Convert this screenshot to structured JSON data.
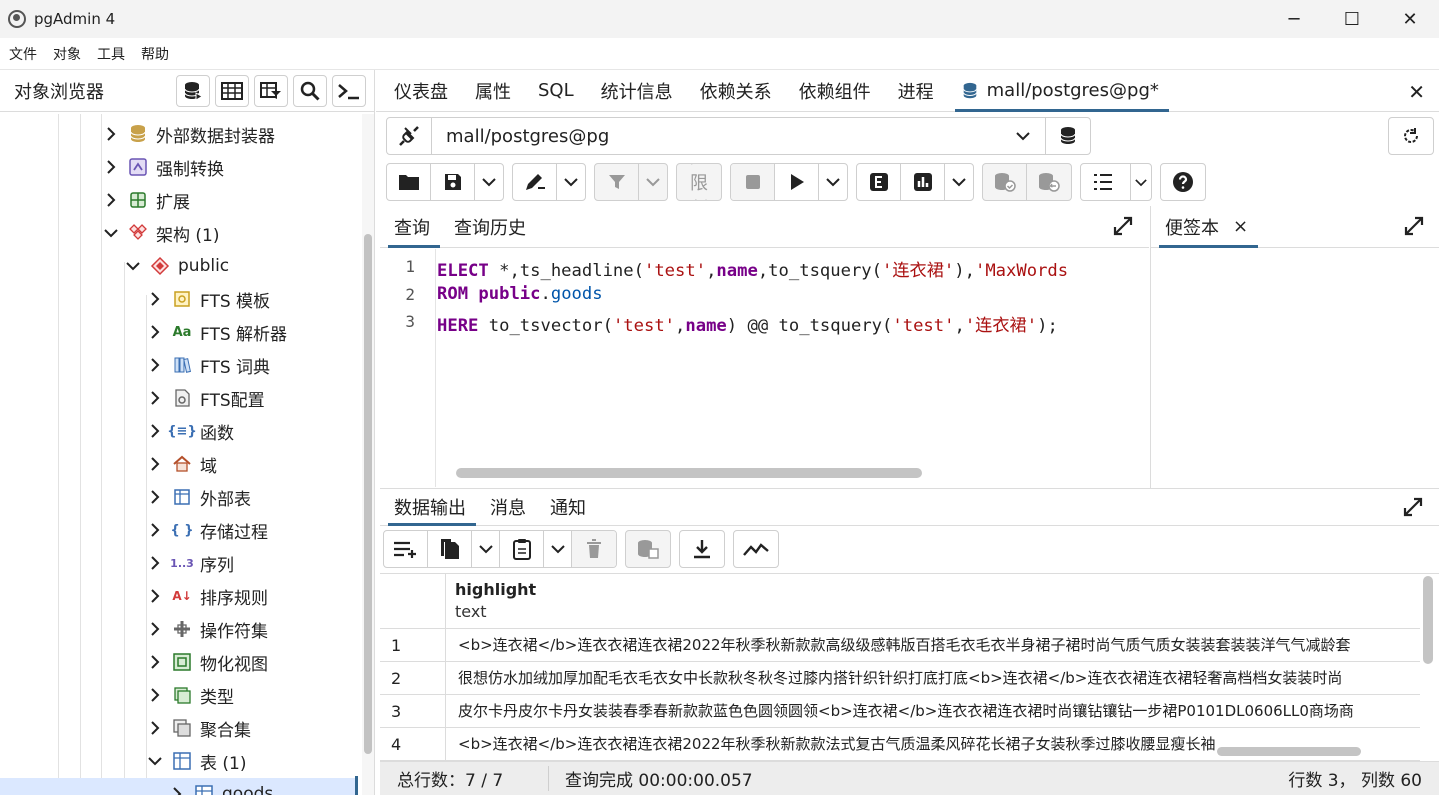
{
  "window": {
    "title": "pgAdmin 4",
    "minimize": "─",
    "maximize": "☐",
    "close": "✕"
  },
  "menubar": [
    "文件",
    "对象",
    "工具",
    "帮助"
  ],
  "browser": {
    "title": "对象浏览器",
    "tree": [
      {
        "label": "外部数据封装器",
        "icon": "database-stack-icon",
        "level": 0,
        "expanded": false
      },
      {
        "label": "强制转换",
        "icon": "cast-icon",
        "level": 0,
        "expanded": false
      },
      {
        "label": "扩展",
        "icon": "extension-icon",
        "level": 0,
        "expanded": false
      },
      {
        "label": "架构 (1)",
        "icon": "schemas-icon",
        "level": 0,
        "expanded": true
      },
      {
        "label": "public",
        "icon": "schema-icon",
        "level": 1,
        "expanded": true
      },
      {
        "label": "FTS 模板",
        "icon": "fts-template-icon",
        "level": 2,
        "expanded": false
      },
      {
        "label": "FTS 解析器",
        "icon": "fts-parser-icon",
        "level": 2,
        "expanded": false
      },
      {
        "label": "FTS 词典",
        "icon": "fts-dictionary-icon",
        "level": 2,
        "expanded": false
      },
      {
        "label": "FTS配置",
        "icon": "fts-config-icon",
        "level": 2,
        "expanded": false
      },
      {
        "label": "函数",
        "icon": "function-icon",
        "level": 2,
        "expanded": false
      },
      {
        "label": "域",
        "icon": "domain-icon",
        "level": 2,
        "expanded": false
      },
      {
        "label": "外部表",
        "icon": "foreign-table-icon",
        "level": 2,
        "expanded": false
      },
      {
        "label": "存储过程",
        "icon": "procedure-icon",
        "level": 2,
        "expanded": false
      },
      {
        "label": "序列",
        "icon": "sequence-icon",
        "level": 2,
        "expanded": false
      },
      {
        "label": "排序规则",
        "icon": "collation-icon",
        "level": 2,
        "expanded": false
      },
      {
        "label": "操作符集",
        "icon": "operator-icon",
        "level": 2,
        "expanded": false
      },
      {
        "label": "物化视图",
        "icon": "materialized-view-icon",
        "level": 2,
        "expanded": false
      },
      {
        "label": "类型",
        "icon": "type-icon",
        "level": 2,
        "expanded": false
      },
      {
        "label": "聚合集",
        "icon": "aggregate-icon",
        "level": 2,
        "expanded": false
      },
      {
        "label": "表 (1)",
        "icon": "tables-icon",
        "level": 2,
        "expanded": true
      },
      {
        "label": "goods",
        "icon": "table-icon",
        "level": 3,
        "expanded": false
      }
    ]
  },
  "tabs": [
    "仪表盘",
    "属性",
    "SQL",
    "统计信息",
    "依赖关系",
    "依赖组件",
    "进程",
    "mall/postgres@pg*"
  ],
  "connection": {
    "value": "mall/postgres@pg"
  },
  "toolbar": {
    "limit": "无限制"
  },
  "query": {
    "tabs": [
      "查询",
      "查询历史"
    ],
    "lines": [
      "1",
      "2",
      "3"
    ],
    "code": {
      "l1a": "ELECT",
      "l1b": " *,ts_headline(",
      "l1c": "'test'",
      "l1d": ",",
      "l1e": "name",
      "l1f": ",to_tsquery(",
      "l1g": "'连衣裙'",
      "l1h": "),",
      "l1i": "'MaxWords",
      "l2a": "ROM",
      "l2b": " ",
      "l2c": "public",
      "l2d": ".",
      "l2e": "goods",
      "l3a": "HERE",
      "l3b": " to_tsvector(",
      "l3c": "'test'",
      "l3d": ",",
      "l3e": "name",
      "l3f": ") @@ to_tsquery(",
      "l3g": "'test'",
      "l3h": ",",
      "l3i": "'连衣裙'",
      "l3j": ");"
    }
  },
  "scratch": {
    "tab": "便签本",
    "close": "×"
  },
  "output": {
    "tabs": [
      "数据输出",
      "消息",
      "通知"
    ],
    "column": {
      "name": "highlight",
      "type": "text"
    },
    "rows": [
      {
        "n": "1",
        "v": "<b>连衣裙</b>连衣衣裙连衣裙2022年秋季秋新款款高级级感韩版百搭毛衣毛衣半身裙子裙时尚气质气质女装装套装装洋气气减龄套"
      },
      {
        "n": "2",
        "v": "很想仿水加绒加厚加配毛衣毛衣女中长款秋冬秋冬过膝内搭针织针织打底打底<b>连衣裙</b>连衣衣裙连衣裙轻奢高档档女装装时尚"
      },
      {
        "n": "3",
        "v": "皮尔卡丹皮尔卡丹女装装春季春新款款蓝色色圆领圆领<b>连衣裙</b>连衣衣裙连衣裙时尚镶钻镶钻一步裙P0101DL0606LL0商场商"
      },
      {
        "n": "4",
        "v": "<b>连衣裙</b>连衣衣裙连衣裙2022年秋季秋新款款法式复古气质温柔风碎花长裙子女装秋季过膝收腰显瘦长袖"
      }
    ]
  },
  "status": {
    "total": "总行数：7 / 7",
    "done": "查询完成 00:00:00.057",
    "pos": "行数 3， 列数 60"
  },
  "colors": {
    "accent": "#326690",
    "keyword": "#770088",
    "string": "#aa1111"
  }
}
